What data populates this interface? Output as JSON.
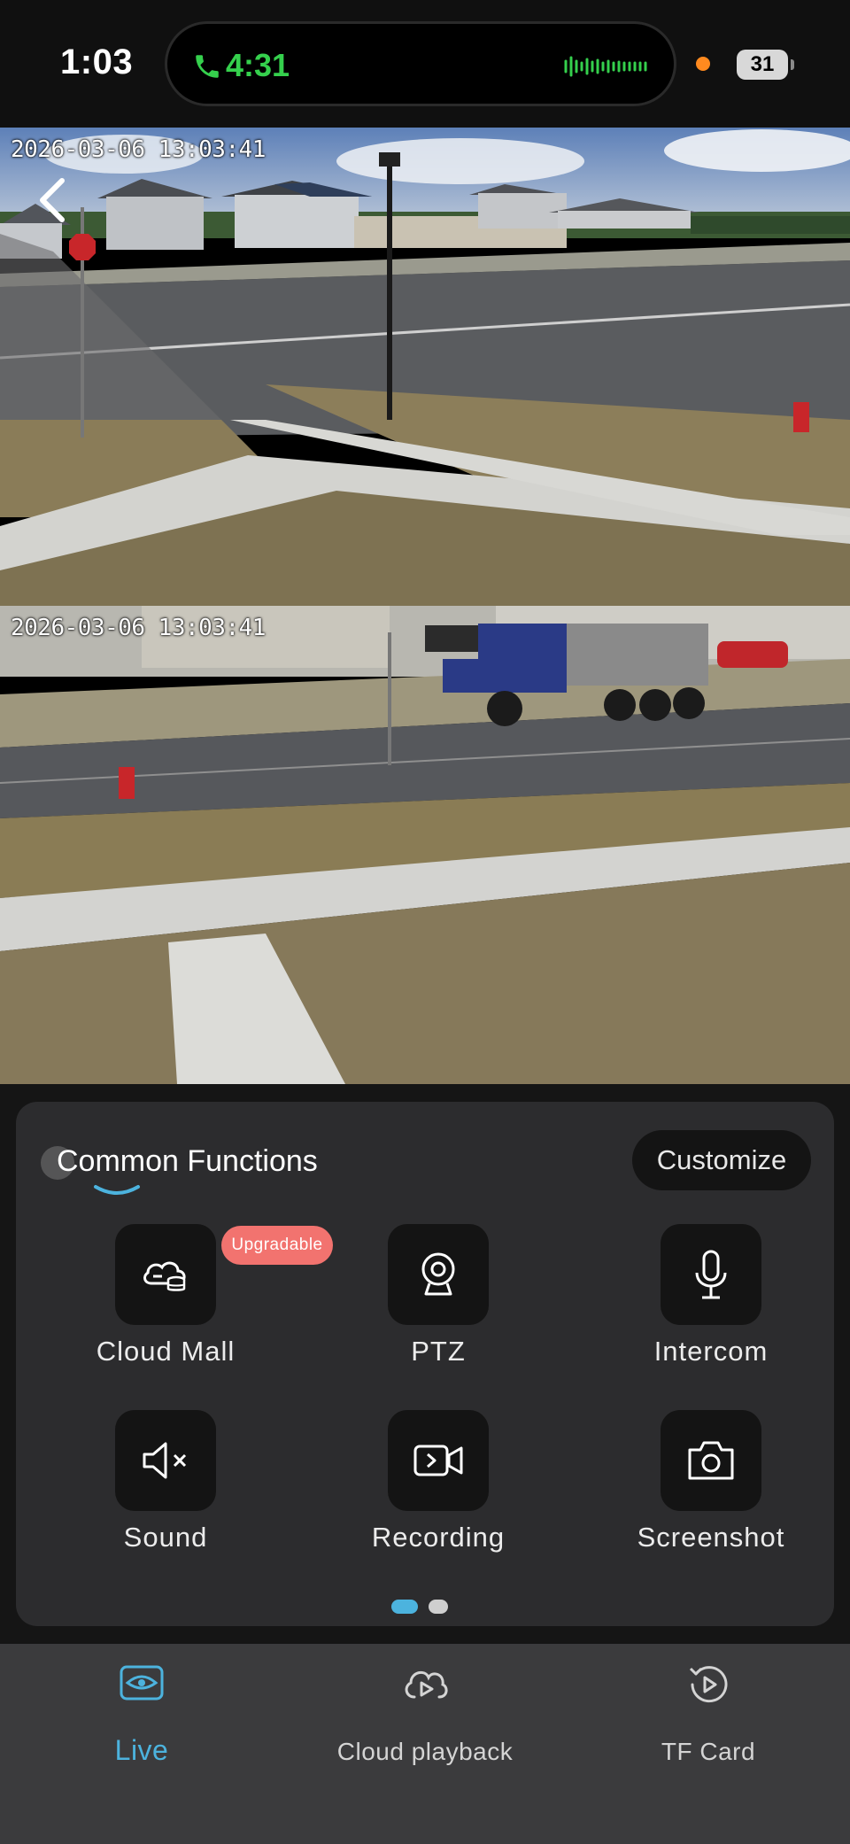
{
  "status_bar": {
    "time": "1:03",
    "call_time": "4:31",
    "battery": "31",
    "call_color": "#35d04d",
    "camera_indicator_color": "#ff8a1f"
  },
  "feeds": [
    {
      "timestamp": "2026-03-06 13:03:41"
    },
    {
      "timestamp": "2026-03-06 13:03:41"
    }
  ],
  "panel": {
    "title": "Common Functions",
    "customize_label": "Customize",
    "functions": [
      {
        "label": "Cloud Mall",
        "icon": "cloud-storage-icon",
        "badge": "Upgradable"
      },
      {
        "label": "PTZ",
        "icon": "webcam-icon"
      },
      {
        "label": "Intercom",
        "icon": "microphone-icon"
      },
      {
        "label": "Sound",
        "icon": "speaker-muted-icon"
      },
      {
        "label": "Recording",
        "icon": "video-record-icon"
      },
      {
        "label": "Screenshot",
        "icon": "camera-icon"
      }
    ],
    "page_indicator": {
      "current": 1,
      "total": 2
    }
  },
  "tabs": [
    {
      "label": "Live",
      "icon": "eye-icon",
      "active": true
    },
    {
      "label": "Cloud playback",
      "icon": "cloud-play-icon",
      "active": false
    },
    {
      "label": "TF Card",
      "icon": "replay-icon",
      "active": false
    }
  ],
  "colors": {
    "accent": "#4cb3de",
    "badge": "#f2736f",
    "panel": "#2c2c2e",
    "tabbar": "#3b3b3d"
  }
}
